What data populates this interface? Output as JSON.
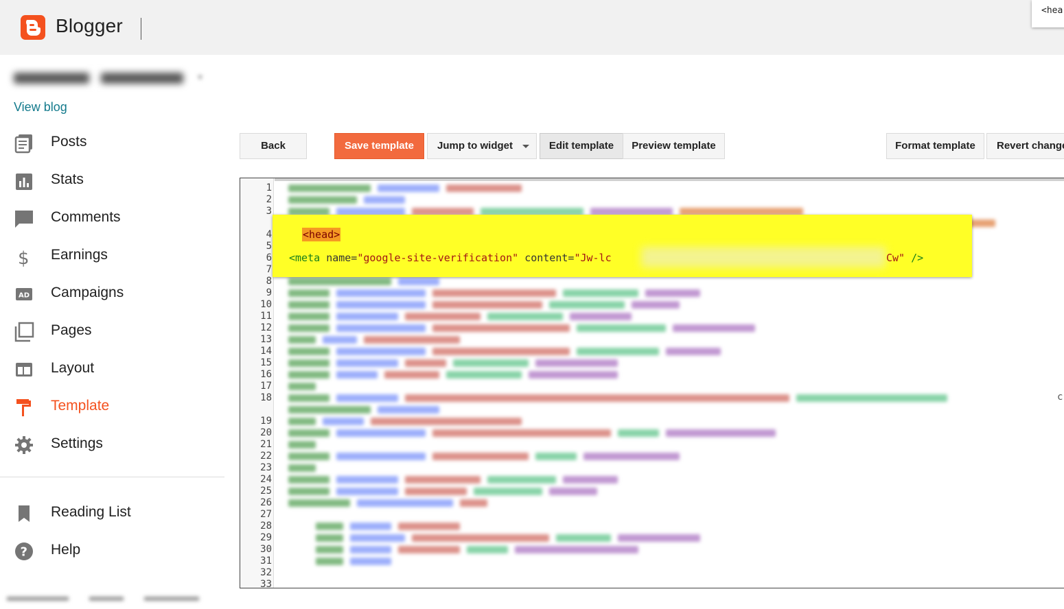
{
  "app": {
    "brand": "Blogger",
    "corner_snippet": "<hea"
  },
  "sidebar": {
    "view_blog": "View blog",
    "items": [
      {
        "label": "Posts",
        "icon": "posts-icon",
        "active": false
      },
      {
        "label": "Stats",
        "icon": "stats-icon",
        "active": false
      },
      {
        "label": "Comments",
        "icon": "comments-icon",
        "active": false
      },
      {
        "label": "Earnings",
        "icon": "dollar-icon",
        "active": false
      },
      {
        "label": "Campaigns",
        "icon": "ad-icon",
        "active": false
      },
      {
        "label": "Pages",
        "icon": "pages-icon",
        "active": false
      },
      {
        "label": "Layout",
        "icon": "layout-icon",
        "active": false
      },
      {
        "label": "Template",
        "icon": "template-icon",
        "active": true
      },
      {
        "label": "Settings",
        "icon": "gear-icon",
        "active": false
      }
    ],
    "secondary": [
      {
        "label": "Reading List",
        "icon": "bookmark-icon"
      },
      {
        "label": "Help",
        "icon": "help-icon"
      }
    ],
    "accent_color": "#f4511e"
  },
  "toolbar": {
    "back": "Back",
    "save": "Save template",
    "jump": "Jump to widget",
    "edit": "Edit template",
    "preview": "Preview template",
    "format": "Format template",
    "revert": "Revert change"
  },
  "editor": {
    "line_numbers": [
      "1",
      "2",
      "3",
      "4",
      "5",
      "6",
      "7",
      "8",
      "9",
      "10",
      "11",
      "12",
      "13",
      "14",
      "15",
      "16",
      "17",
      "18",
      "19",
      "20",
      "21",
      "22",
      "23",
      "24",
      "25",
      "26",
      "27",
      "28",
      "29",
      "30",
      "31",
      "32",
      "33"
    ],
    "highlight": {
      "head_tag": "<head>",
      "meta_open": "<meta",
      "meta_name_attr": "name=",
      "meta_name_val": "\"google-site-verification\"",
      "meta_content_attr": "content=",
      "meta_content_val_start": "\"Jw-lc",
      "meta_content_val_end": "Cw\"",
      "meta_close": "/>"
    },
    "overflow_char": "c"
  }
}
